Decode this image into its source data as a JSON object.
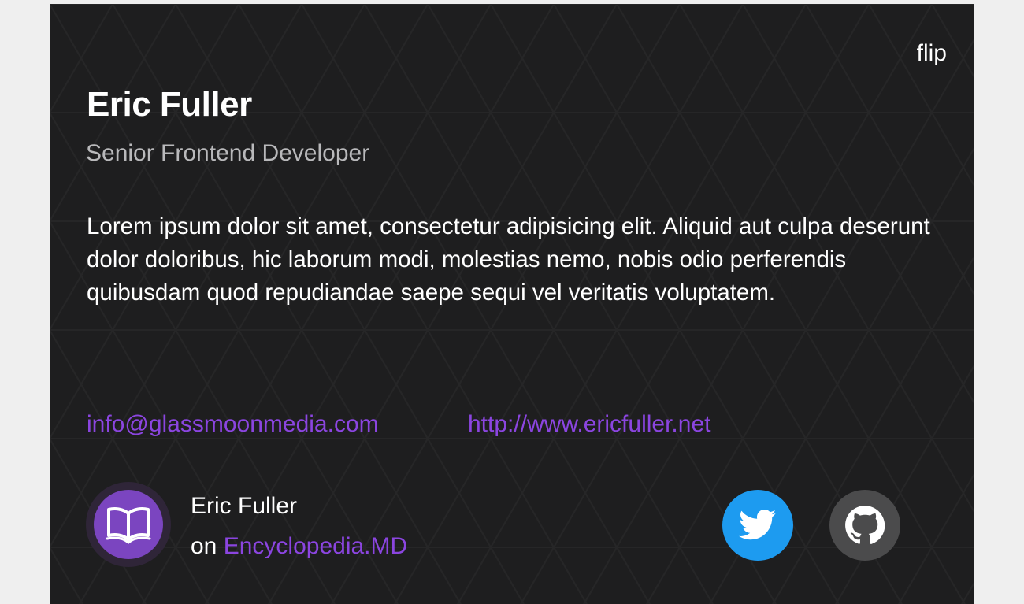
{
  "card": {
    "flip_label": "flip",
    "name": "Eric Fuller",
    "title": "Senior Frontend Developer",
    "bio": "Lorem ipsum dolor sit amet, consectetur adipisicing elit. Aliquid aut culpa deserunt dolor doloribus, hic laborum modi, molestias nemo, nobis odio perferendis quibusdam quod repudiandae saepe sequi vel veritatis voluptatem.",
    "email": "info@glassmoonmedia.com",
    "website": "http://www.ericfuller.net"
  },
  "author": {
    "name": "Eric Fuller",
    "on_label": "on",
    "site": "Encyclopedia.MD",
    "avatar_icon": "open-book-icon"
  },
  "social": [
    {
      "name": "twitter",
      "icon": "twitter-bird-icon",
      "color": "#1d9bf0"
    },
    {
      "name": "github",
      "icon": "github-octocat-icon",
      "color": "#4b4b4c"
    }
  ],
  "colors": {
    "card_background": "#1e1e1f",
    "page_background": "#efefef",
    "accent": "#8b45e0",
    "subtitle": "#b9b9bb"
  }
}
